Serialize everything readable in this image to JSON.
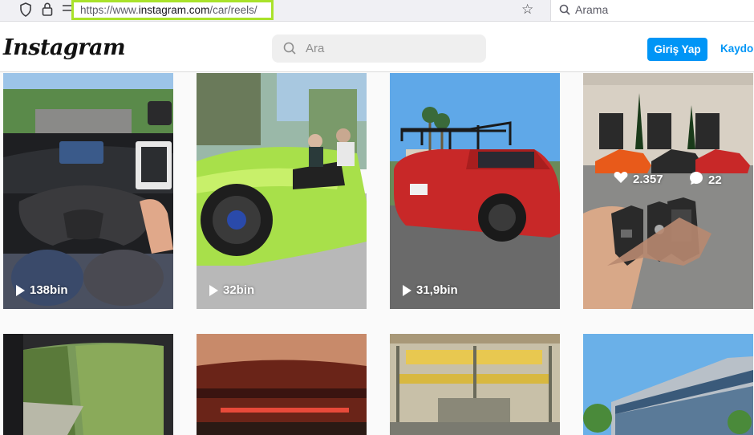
{
  "browser": {
    "url_prefix": "https://www.",
    "url_domain": "instagram.com",
    "url_path": "/car/reels/",
    "search_placeholder": "Arama"
  },
  "header": {
    "logo": "Instagram",
    "search_placeholder": "Ara",
    "login_label": "Giriş Yap",
    "signup_label": "Kaydol"
  },
  "colors": {
    "accent": "#0095f6",
    "url_highlight": "#a9e22a"
  },
  "reels": [
    {
      "views": "138bin"
    },
    {
      "views": "32bin"
    },
    {
      "views": "31,9bin"
    },
    {
      "likes": "2.357",
      "comments": "22"
    }
  ]
}
